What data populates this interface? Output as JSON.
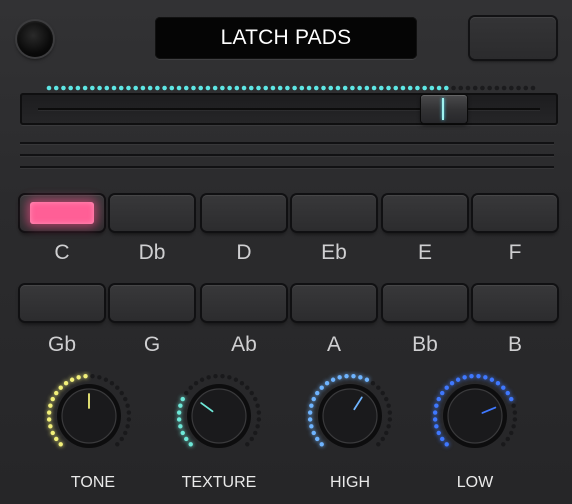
{
  "title": "LATCH PADS",
  "meter": {
    "lit_fraction": 0.82,
    "color": "#5ee6e4",
    "dim_color": "#1b1b1d"
  },
  "slider": {
    "value_fraction": 0.82,
    "accent": "#9ff3f0"
  },
  "pads_row1": [
    {
      "note": "C",
      "active": true
    },
    {
      "note": "Db",
      "active": false
    },
    {
      "note": "D",
      "active": false
    },
    {
      "note": "Eb",
      "active": false
    },
    {
      "note": "E",
      "active": false
    },
    {
      "note": "F",
      "active": false
    }
  ],
  "pads_row2": [
    {
      "note": "Gb",
      "active": false
    },
    {
      "note": "G",
      "active": false
    },
    {
      "note": "Ab",
      "active": false
    },
    {
      "note": "A",
      "active": false
    },
    {
      "note": "Bb",
      "active": false
    },
    {
      "note": "B",
      "active": false
    }
  ],
  "knobs": [
    {
      "label": "TONE",
      "value": 0.5,
      "color": "#f2f07a"
    },
    {
      "label": "TEXTURE",
      "value": 0.3,
      "color": "#6ee8d8"
    },
    {
      "label": "HIGH",
      "value": 0.62,
      "color": "#6fb4ff"
    },
    {
      "label": "LOW",
      "value": 0.75,
      "color": "#3f78ff"
    }
  ],
  "colors": {
    "pad_active": "#ff5f96",
    "background": "#2a2a2c"
  }
}
